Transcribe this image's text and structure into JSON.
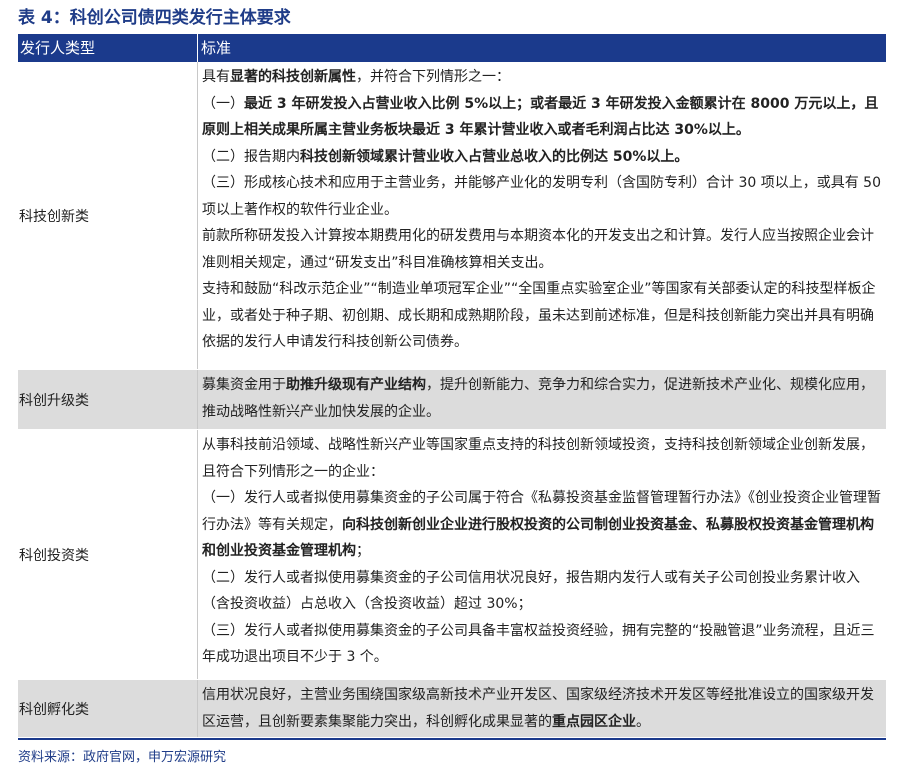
{
  "title": "表 4：科创公司债四类发行主体要求",
  "header": {
    "col1": "发行人类型",
    "col2": "标准"
  },
  "rows": {
    "r1": {
      "category": "科技创新类",
      "p1": {
        "t1": "具有",
        "b1": "显著的科技创新属性",
        "t2": "，并符合下列情形之一："
      },
      "p2": {
        "t1": "（一）",
        "b1": "最近 3 年研发投入占营业收入比例 5%以上；或者最近 3 年研发投入金额累计在 8000 万元以上，且原则上相关成果所属主营业务板块最近 3 年累计营业收入或者毛利润占比达 30%以上。"
      },
      "p3": {
        "t1": "（二）报告期内",
        "b1": "科技创新领域累计营业收入占营业总收入的比例达 50%以上。"
      },
      "p4": "（三）形成核心技术和应用于主营业务，并能够产业化的发明专利（含国防专利）合计 30 项以上，或具有 50 项以上著作权的软件行业企业。",
      "p5": "前款所称研发投入计算按本期费用化的研发费用与本期资本化的开发支出之和计算。发行人应当按照企业会计准则相关规定，通过“研发支出”科目准确核算相关支出。",
      "p6": "支持和鼓励“科改示范企业”“制造业单项冠军企业”“全国重点实验室企业”等国家有关部委认定的科技型样板企业，或者处于种子期、初创期、成长期和成熟期阶段，虽未达到前述标准，但是科技创新能力突出并具有明确依据的发行人申请发行科技创新公司债券。"
    },
    "r2": {
      "category": "科创升级类",
      "p1": {
        "t1": "募集资金用于",
        "b1": "助推升级现有产业结构",
        "t2": "，提升创新能力、竞争力和综合实力，促进新技术产业化、规模化应用，推动战略性新兴产业加快发展的企业。"
      }
    },
    "r3": {
      "category": "科创投资类",
      "p1": "从事科技前沿领域、战略性新兴产业等国家重点支持的科技创新领域投资，支持科技创新领域企业创新发展，且符合下列情形之一的企业：",
      "p2": {
        "t1": "（一）发行人或者拟使用募集资金的子公司属于符合《私募投资基金监督管理暂行办法》《创业投资企业管理暂行办法》等有关规定，",
        "b1": "向科技创新创业企业进行股权投资的公司制创业投资基金、私募股权投资基金管理机构和创业投资基金管理机构",
        "t2": "；"
      },
      "p3": "（二）发行人或者拟使用募集资金的子公司信用状况良好，报告期内发行人或有关子公司创投业务累计收入（含投资收益）占总收入（含投资收益）超过 30%；",
      "p4": "（三）发行人或者拟使用募集资金的子公司具备丰富权益投资经验，拥有完整的“投融管退”业务流程，且近三年成功退出项目不少于 3 个。"
    },
    "r4": {
      "category": "科创孵化类",
      "p1": {
        "t1": "信用状况良好，主营业务围绕国家级高新技术产业开发区、国家级经济技术开发区等经批准设立的国家级开发区运营，且创新要素集聚能力突出，科创孵化成果显著的",
        "b1": "重点园区企业",
        "t2": "。"
      }
    }
  },
  "source": "资料来源：政府官网，申万宏源研究",
  "colors": {
    "header_bg": "#1b3a8c",
    "title": "#1f3c88",
    "shaded_row": "#dcdcdc"
  }
}
